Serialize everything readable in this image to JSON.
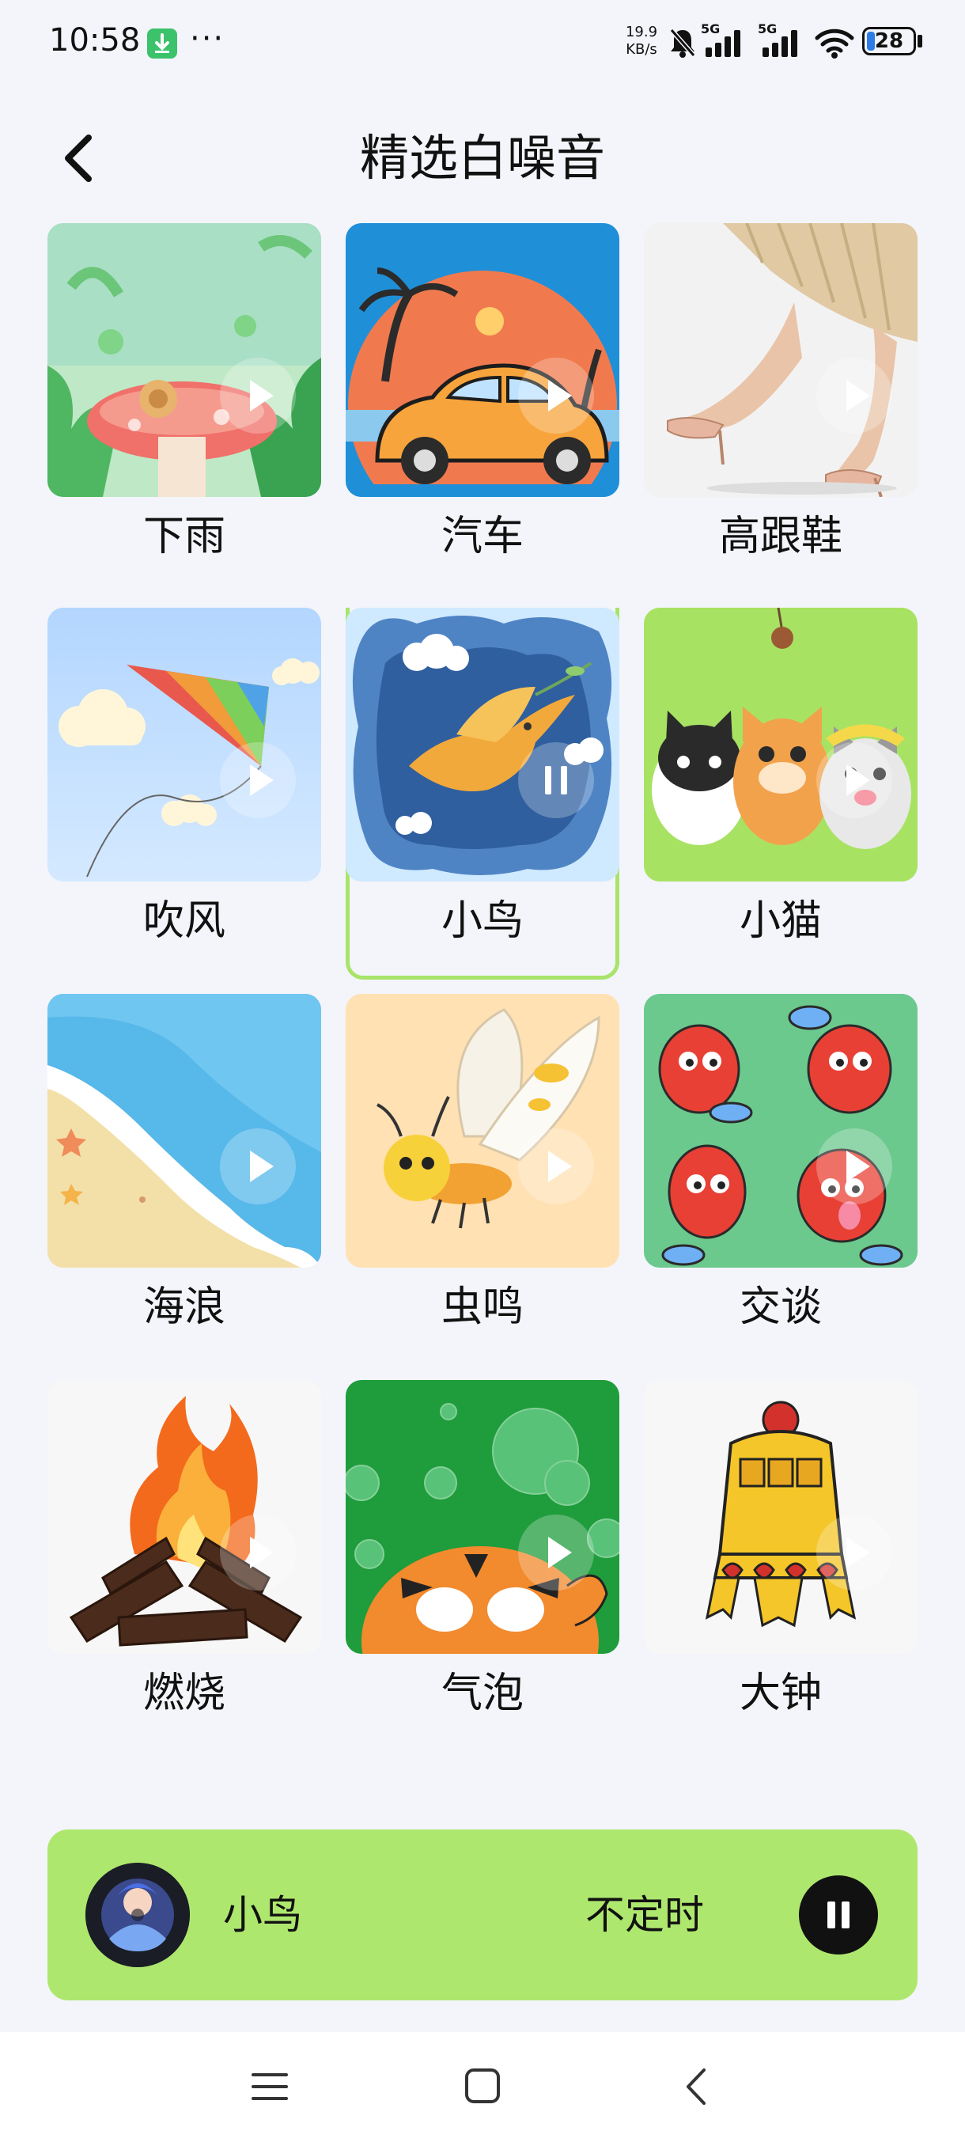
{
  "status_bar": {
    "time": "10:58",
    "net_speed_value": "19.9",
    "net_speed_unit": "KB/s",
    "signal_1_label": "5G",
    "signal_2_label": "5G",
    "battery": "28",
    "more_indicator": "···"
  },
  "header": {
    "title": "精选白噪音",
    "back_icon": "chevron-left-icon"
  },
  "grid": {
    "items": [
      {
        "label": "下雨",
        "state": "play",
        "theme": "#bfe8c6"
      },
      {
        "label": "汽车",
        "state": "play",
        "theme": "#1f8fd8"
      },
      {
        "label": "高跟鞋",
        "state": "play",
        "theme": "#eeeeee"
      },
      {
        "label": "吹风",
        "state": "play",
        "theme": "#b8dcff"
      },
      {
        "label": "小鸟",
        "state": "pause",
        "theme": "#4f84c4",
        "selected": true
      },
      {
        "label": "小猫",
        "state": "play",
        "theme": "#a8e263"
      },
      {
        "label": "海浪",
        "state": "play",
        "theme": "#f3e0a8"
      },
      {
        "label": "虫鸣",
        "state": "play",
        "theme": "#ffe1b3"
      },
      {
        "label": "交谈",
        "state": "play",
        "theme": "#6cc98e"
      },
      {
        "label": "燃烧",
        "state": "play",
        "theme": "#f7f7f7"
      },
      {
        "label": "气泡",
        "state": "play",
        "theme": "#1f9c3c"
      },
      {
        "label": "大钟",
        "state": "play",
        "theme": "#f7f7f7"
      }
    ]
  },
  "player": {
    "title": "小鸟",
    "timer_label": "不定时",
    "state": "playing",
    "accent": "#aee76e"
  },
  "nav_bar": {
    "menu_icon": "menu-icon",
    "home_icon": "home-icon",
    "back_icon": "back-icon"
  }
}
